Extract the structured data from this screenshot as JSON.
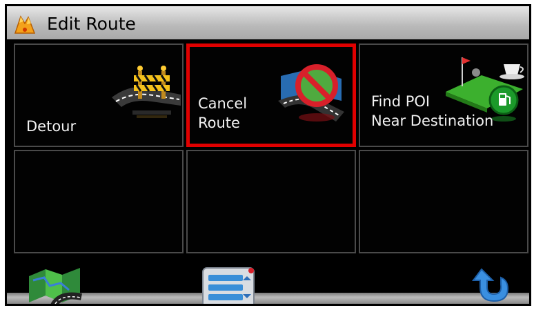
{
  "title": "Edit Route",
  "tiles": [
    {
      "label_line1": "Detour",
      "label_line2": "",
      "icon": "road-barrier-icon",
      "selected": false
    },
    {
      "label_line1": "Cancel",
      "label_line2": "Route",
      "icon": "no-route-icon",
      "selected": true
    },
    {
      "label_line1": "Find POI",
      "label_line2": "Near Destination",
      "icon": "poi-gas-icon",
      "selected": false
    },
    {
      "label_line1": "",
      "label_line2": "",
      "icon": "",
      "selected": false
    },
    {
      "label_line1": "",
      "label_line2": "",
      "icon": "",
      "selected": false
    },
    {
      "label_line1": "",
      "label_line2": "",
      "icon": "",
      "selected": false
    }
  ],
  "bottom_buttons": [
    "map-icon",
    "route-list-icon",
    "back-arrow-icon"
  ],
  "colors": {
    "selection": "#e00000",
    "titlebar": "#c4c4c4",
    "tile_background": "#020202"
  }
}
